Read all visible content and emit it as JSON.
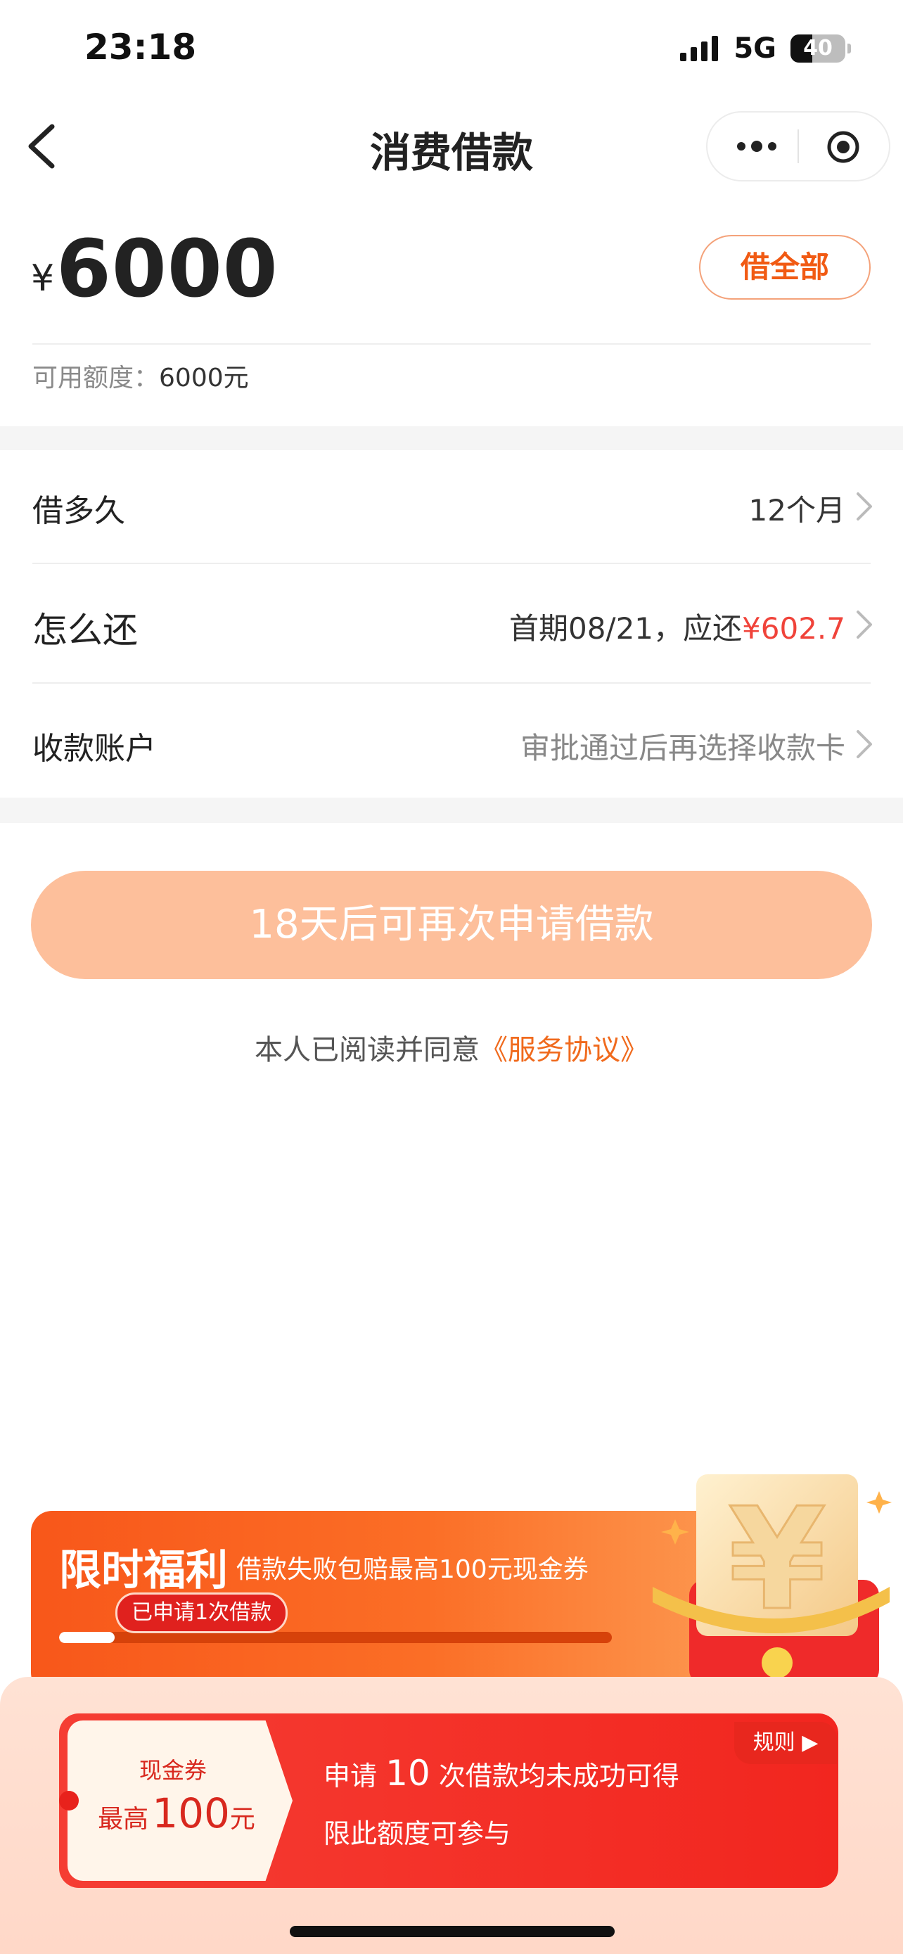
{
  "status_bar": {
    "time": "23:18",
    "network": "5G",
    "battery": "40",
    "battery_level": 0.4
  },
  "nav": {
    "title": "消费借款",
    "back_icon": "chevron-left-icon",
    "more_icon": "more-dots-icon",
    "close_icon": "target-circle-icon"
  },
  "amount": {
    "currency": "¥",
    "value": "6000",
    "borrow_all_label": "借全部"
  },
  "quota": {
    "label": "可用额度：",
    "value": "6000元"
  },
  "rows": [
    {
      "label": "借多久",
      "value": "12个月"
    },
    {
      "label": "怎么还",
      "value_prefix": "首期08/21，应还",
      "value_highlight": "¥602.7"
    },
    {
      "label": "收款账户",
      "value": "审批通过后再选择收款卡"
    }
  ],
  "apply_button": {
    "label": "18天后可再次申请借款"
  },
  "agreement": {
    "text": "本人已阅读并同意",
    "link": "《服务协议》"
  },
  "promo": {
    "title": "限时福利",
    "subtitle": "借款失败包赔最高100元现金券",
    "applied_badge": "已申请1次借款",
    "progress": 0.1,
    "coupon_label": "现金券",
    "coupon_prefix": "最高",
    "coupon_amount": "100",
    "coupon_unit": "元",
    "rules_label": "规则 ▶",
    "main_prefix": "申请",
    "main_count": "10",
    "main_suffix": "次借款均未成功可得",
    "sub_text": "限此额度可参与"
  },
  "colors": {
    "accent": "#f15a13",
    "highlight_red": "#f0433a",
    "button_disabled": "#fdbf9b"
  }
}
